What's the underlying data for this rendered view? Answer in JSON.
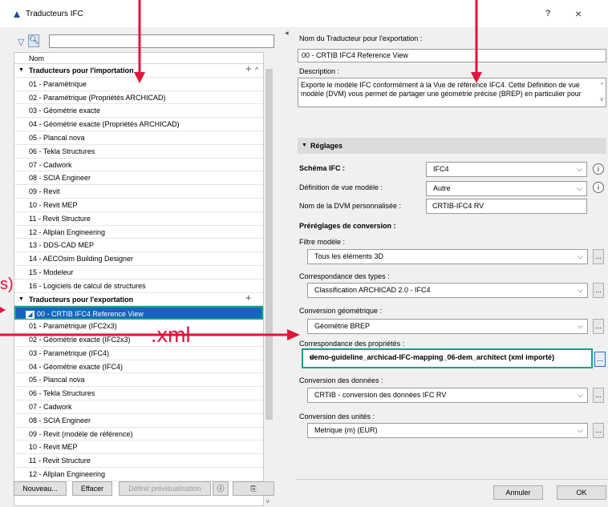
{
  "window": {
    "title": "Traducteurs IFC",
    "help": "?",
    "close": "×"
  },
  "left": {
    "column_header": "Nom",
    "import_group": "Traducteurs pour l'importation",
    "import_items": [
      "01 - Paramétrique",
      "02 - Paramétrique (Propriétés ARCHICAD)",
      "03 - Géométrie exacte",
      "04 - Géométrie exacte (Propriétés ARCHICAD)",
      "05 - Plancal nova",
      "06 - Tekla Structures",
      "07 - Cadwork",
      "08 - SCIA Engineer",
      "09 - Revit",
      "10 - Revit MEP",
      "11 - Revit Structure",
      "12 - Allplan Engineering",
      "13 - DDS-CAD MEP",
      "14 - AECOsim Building Designer",
      "15 - Modeleur",
      "16 - Logiciels de calcul de structures"
    ],
    "export_group": "Traducteurs pour l'exportation",
    "selected_item": "00 - CRTIB IFC4 Reference View",
    "export_items": [
      "01 - Paramétrique (IFC2x3)",
      "02 - Géométrie exacte (IFC2x3)",
      "03 - Paramétrique (IFC4)",
      "04 - Géométrie exacte (IFC4)",
      "05 - Plancal nova",
      "06 - Tekla Structures",
      "07 - Cadwork",
      "08 - SCIA Engineer",
      "09 - Revit (modèle de référence)",
      "10 - Revit MEP",
      "11 - Revit Structure",
      "12 - Allplan Engineering"
    ],
    "buttons": {
      "new": "Nouveau...",
      "delete": "Effacer",
      "preview": "Définir prévisualisation"
    }
  },
  "right": {
    "name_label": "Nom du Traducteur pour l'exportation :",
    "name_value": "00 - CRTIB IFC4 Reference View",
    "desc_label": "Description :",
    "desc_value": "Exporte le modèle IFC conformément à la Vue de référence IFC4. Cette Définition de vue modèle (DVM) vous permet de partager une géométrie précise (BREP) en particulier pour",
    "settings_section": "Réglages",
    "schema_label": "Schéma IFC :",
    "schema_value": "IFC4",
    "mvd_label": "Définition de vue modèle :",
    "mvd_value": "Autre",
    "custom_mvd_label": "Nom de la DVM personnalisée :",
    "custom_mvd_value": "CRTIB-IFC4 RV",
    "presets_label": "Préréglages de conversion :",
    "model_filter_label": "Filtre modèle :",
    "model_filter_value": "Tous les éléments 3D",
    "type_mapping_label": "Correspondance des types :",
    "type_mapping_value": "Classification ARCHICAD 2.0 - IFC4",
    "geometry_label": "Conversion géométrique :",
    "geometry_value": "Géométrie BREP",
    "property_mapping_label": "Correspondance des propriétés :",
    "property_mapping_value": "demo-guideline_archicad-IFC-mapping_06-dem_architect (xml importé)",
    "data_conv_label": "Conversion des données :",
    "data_conv_value": "CRTIB - conversion des données IFC RV",
    "unit_conv_label": "Conversion des unités :",
    "unit_conv_value": "Metrique (m) (EUR)",
    "dots": "...",
    "cancel": "Annuler",
    "ok": "OK"
  },
  "annotation": {
    "xml_label": ".xml",
    "cut_label": "s)",
    "accent": "#e0143c"
  }
}
